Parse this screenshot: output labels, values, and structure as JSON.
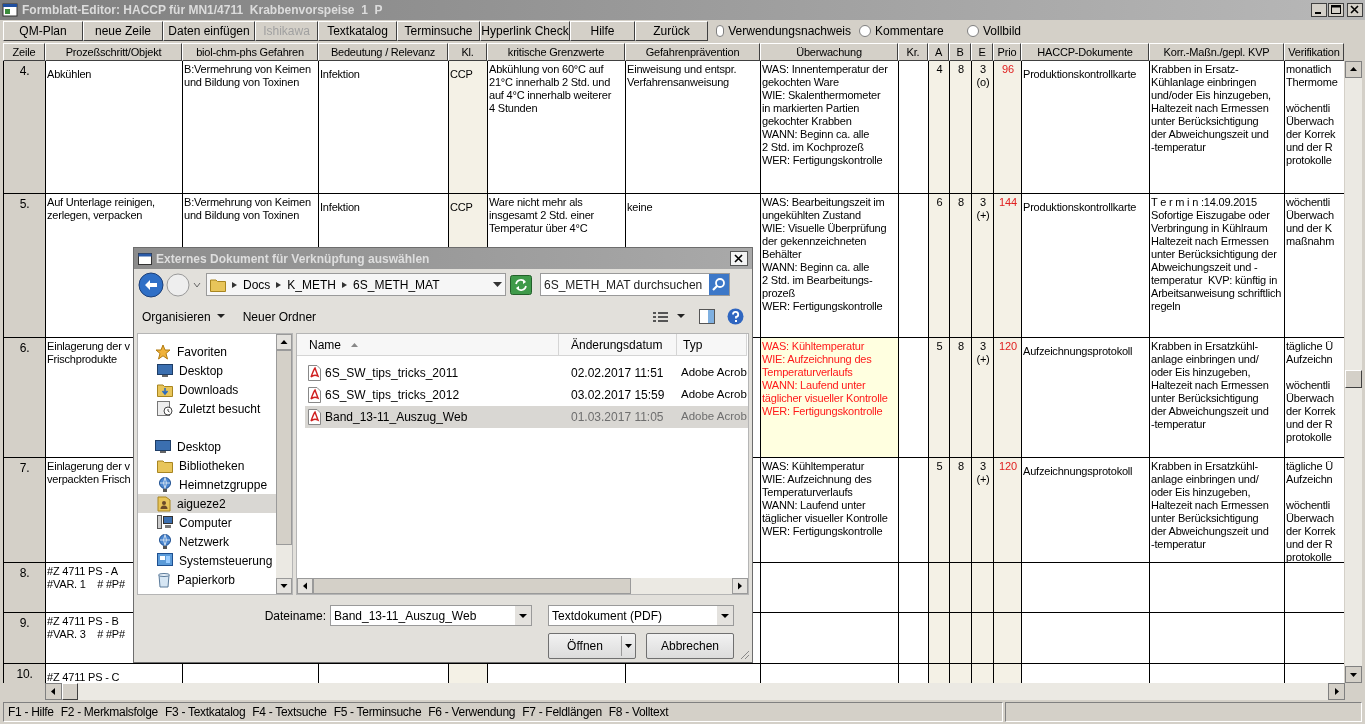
{
  "window": {
    "title": "Formblatt-Editor: HACCP für MN1/4711  Krabbenvorspeise  1  P"
  },
  "toolbar": [
    {
      "label": "QM-Plan",
      "disabled": false
    },
    {
      "label": "neue Zeile",
      "disabled": false
    },
    {
      "label": "Daten einfügen",
      "disabled": false
    },
    {
      "label": "Ishikawa",
      "disabled": true
    },
    {
      "label": "Textkatalog",
      "disabled": false
    },
    {
      "label": "Terminsuche",
      "disabled": false
    },
    {
      "label": "Hyperlink Check",
      "disabled": false
    },
    {
      "label": "Hilfe",
      "disabled": false
    },
    {
      "label": "Zurück",
      "disabled": false
    }
  ],
  "options": [
    {
      "label": "Verwendungsnachweis",
      "checked": false
    },
    {
      "label": "Kommentare",
      "checked": false
    },
    {
      "label": "Vollbild",
      "checked": false
    }
  ],
  "table": {
    "columns": [
      "Zeile",
      "Prozeßschritt/Objekt",
      "biol-chm-phs Gefahren",
      "Bedeutung / Relevanz",
      "Kl.",
      "kritische Grenzwerte",
      "Gefahrenprävention",
      "Überwachung",
      "Kr.",
      "A",
      "B",
      "E",
      "Prio",
      "HACCP-Dokumente",
      "Korr.-Maßn./gepl. KVP",
      "Verifikation"
    ],
    "rows": [
      {
        "number": "4.",
        "process": "Abkühlen",
        "hazards": "B:Vermehrung von Keimen\nund Bildung von Toxinen",
        "significance": "Infektion",
        "class": "CCP",
        "limits": "Abkühlung von 60°C auf\n21°C innerhalb 2 Std. und\nauf 4°C innerhalb weiterer\n4 Stunden",
        "prevention": "Einweisung und entspr.\nVerfahrensanweisung",
        "monitoring": "WAS: Innentemperatur der\ngekochten Ware\nWIE: Skalenthermometer\nin markierten Partien\ngekochter Krabben\nWANN: Beginn ca. alle\n2 Std. im Kochprozeß\nWER: Fertigungskontrolle",
        "monitoring_highlighted": false,
        "a": "4",
        "b": "8",
        "e": "3\n(o)",
        "prio": "96",
        "documents": "Produktionskontrollkarte",
        "corrective": "Krabben in Ersatz-\nKühlanlage einbringen\nund/oder Eis hinzugeben,\nHaltezeit nach Ermessen\nunter Berücksichtigung\nder Abweichungszeit und\n-temperatur",
        "verification": "monatlich\nThermome\n\nwöchentli\nÜberwach\nder Korrek\nund der R\nprotokolle"
      },
      {
        "number": "5.",
        "process": "Auf Unterlage reinigen,\nzerlegen, verpacken",
        "hazards": "B:Vermehrung von Keimen\nund Bildung von Toxinen",
        "significance": "Infektion",
        "class": "CCP",
        "limits": "Ware nicht mehr als\ninsgesamt 2 Std. einer\nTemperatur über 4°C",
        "prevention": "keine",
        "monitoring": "WAS: Bearbeitungszeit im\nungekühlten Zustand\nWIE: Visuelle Überprüfung\nder gekennzeichneten\nBehälter\nWANN: Beginn ca. alle\n2 Std. im Bearbeitungs-\nprozeß\nWER: Fertigungskontrolle",
        "monitoring_highlighted": false,
        "a": "6",
        "b": "8",
        "e": "3\n(+)",
        "prio": "144",
        "documents": "Produktionskontrollkarte",
        "corrective": "T e r m i n :14.09.2015\nSofortige Eiszugabe oder\nVerbringung in Kühlraum\nHaltezeit nach Ermessen\nunter Berücksichtigung der\nAbweichungszeit und -\ntemperatur  KVP: künftig in\nArbeitsanweisung schriftlich\nregeln",
        "verification": "wöchentli\nÜberwach\nund der K\nmaßnahm"
      },
      {
        "number": "6.",
        "process": "Einlagerung der v\nFrischprodukte",
        "monitoring": "WAS: Kühltemperatur\nWIE: Aufzeichnung des\nTemperaturverlaufs\nWANN: Laufend unter\ntäglicher visueller Kontrolle\nWER: Fertigungskontrolle",
        "monitoring_highlighted": true,
        "a": "5",
        "b": "8",
        "e": "3\n(+)",
        "prio": "120",
        "documents": "Aufzeichnungsprotokoll",
        "corrective": "Krabben in Ersatzkühl-\nanlage einbringen und/\noder Eis hinzugeben,\nHaltezeit nach Ermessen\nunter Berücksichtigung\nder Abweichungszeit und\n-temperatur",
        "verification": "tägliche Ü\nAufzeichn\n\nwöchentli\nÜberwach\nder Korrek\nund der R\nprotokolle"
      },
      {
        "number": "7.",
        "process": "Einlagerung der v\nverpackten Frisch",
        "monitoring": "WAS: Kühltemperatur\nWIE: Aufzeichnung des\nTemperaturverlaufs\nWANN: Laufend unter\ntäglicher visueller Kontrolle\nWER: Fertigungskontrolle",
        "monitoring_highlighted": false,
        "a": "5",
        "b": "8",
        "e": "3\n(+)",
        "prio": "120",
        "documents": "Aufzeichnungsprotokoll",
        "corrective": "Krabben in Ersatzkühl-\nanlage einbringen und/\noder Eis hinzugeben,\nHaltezeit nach Ermessen\nunter Berücksichtigung\nder Abweichungszeit und\n-temperatur",
        "verification": "tägliche Ü\nAufzeichn\n\nwöchentli\nÜberwach\nder Korrek\nund der R\nprotokolle"
      },
      {
        "number": "8.",
        "process": "#Z 4711 PS - A\n#VAR. 1    # #P#"
      },
      {
        "number": "9.",
        "process": "#Z 4711 PS - B\n#VAR. 3    # #P#"
      },
      {
        "number": "10.",
        "process": "#Z 4711 PS - C"
      }
    ]
  },
  "status_bar": {
    "items": [
      "F1 - Hilfe",
      "F2 - Merkmalsfolge",
      "F3 - Textkatalog",
      "F4 - Textsuche",
      "F5 - Terminsuche",
      "F6 - Verwendung",
      "F7 - Feldlängen",
      "F8 - Volltext"
    ]
  },
  "dialog": {
    "title": "Externes Dokument für Verknüpfung auswählen",
    "breadcrumb": [
      "Docs",
      "K_METH",
      "6S_METH_MAT"
    ],
    "search": {
      "placeholder": "6S_METH_MAT durchsuchen"
    },
    "commands": [
      {
        "label": "Organisieren",
        "kind": "menu"
      },
      {
        "label": "Neuer Ordner",
        "kind": "button"
      }
    ],
    "nav": [
      {
        "label": "Favoriten",
        "selected": false,
        "children": [
          {
            "label": "Desktop",
            "selected": false
          },
          {
            "label": "Downloads",
            "selected": false
          },
          {
            "label": "Zuletzt besucht",
            "selected": false
          }
        ]
      },
      {
        "label": "Desktop",
        "selected": false,
        "children": [
          {
            "label": "Bibliotheken",
            "selected": false
          },
          {
            "label": "Heimnetzgruppe",
            "selected": false
          },
          {
            "label": "aigueze2",
            "selected": true
          },
          {
            "label": "Computer",
            "selected": false
          },
          {
            "label": "Netzwerk",
            "selected": false
          },
          {
            "label": "Systemsteuerung",
            "selected": false
          },
          {
            "label": "Papierkorb",
            "selected": false
          }
        ]
      }
    ],
    "files": {
      "columns": [
        "Name",
        "Änderungsdatum",
        "Typ"
      ],
      "rows": [
        {
          "name": "6S_SW_tips_tricks_2011",
          "date": "02.02.2017 11:51",
          "type": "Adobe Acrob",
          "selected": false
        },
        {
          "name": "6S_SW_tips_tricks_2012",
          "date": "03.02.2017 15:59",
          "type": "Adobe Acrob",
          "selected": false
        },
        {
          "name": "Band_13-11_Auszug_Web",
          "date": "01.03.2017 11:05",
          "type": "Adobe Acrob",
          "selected": true
        }
      ]
    },
    "filename": {
      "label": "Dateiname:",
      "value": "Band_13-11_Auszug_Web"
    },
    "filetype": "Textdokument (PDF)",
    "buttons": [
      "Öffnen",
      "Abbrechen"
    ]
  }
}
